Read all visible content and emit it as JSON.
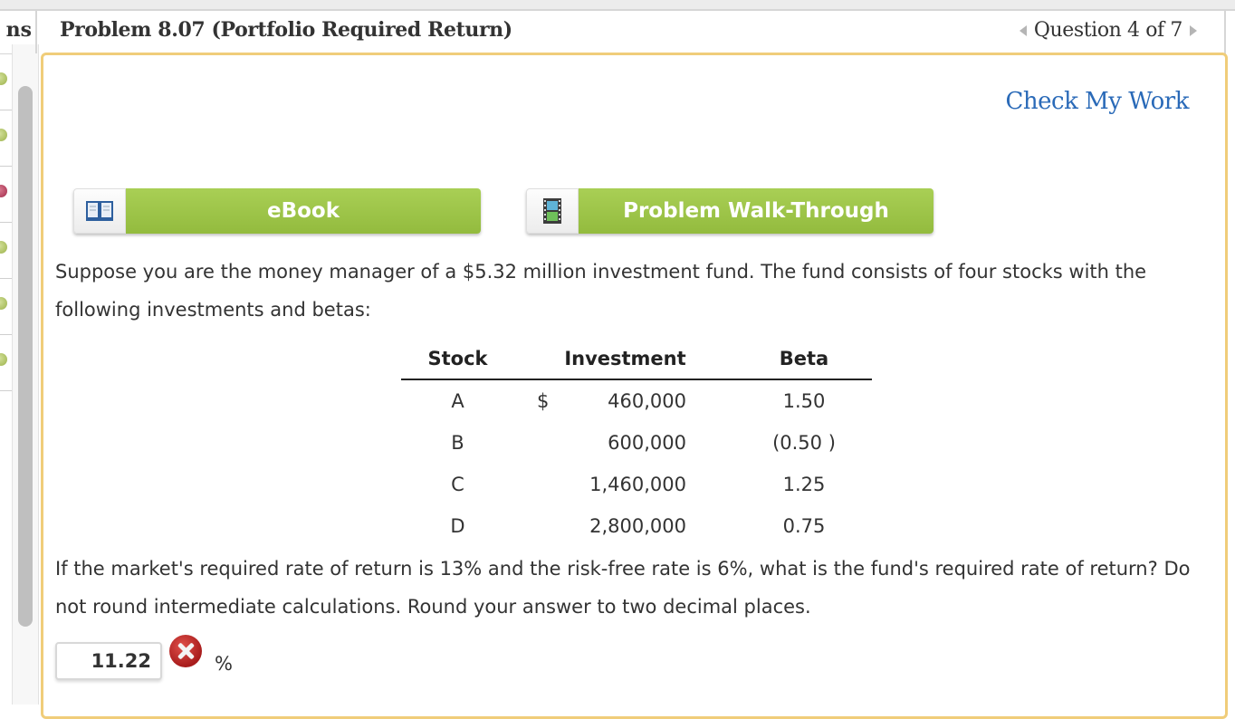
{
  "sidebar": {
    "header_fragment": "ns",
    "items": [
      {
        "status": "correct"
      },
      {
        "status": "correct"
      },
      {
        "status": "incorrect"
      },
      {
        "status": "correct"
      },
      {
        "status": "correct"
      },
      {
        "status": "correct"
      }
    ]
  },
  "header": {
    "title": "Problem 8.07 (Portfolio Required Return)",
    "question_nav": "Question 4 of 7"
  },
  "main": {
    "check_my_work": "Check My Work",
    "buttons": {
      "ebook": {
        "label": "eBook",
        "icon": "book-icon"
      },
      "walkthrough": {
        "label": "Problem Walk-Through",
        "icon": "film-icon"
      }
    },
    "intro": "Suppose you are the money manager of a $5.32 million investment fund. The fund consists of four stocks with the following investments and betas:",
    "table": {
      "headers": [
        "Stock",
        "Investment",
        "Beta"
      ],
      "rows": [
        {
          "stock": "A",
          "currency": "$",
          "investment": "460,000",
          "beta": "1.50"
        },
        {
          "stock": "B",
          "currency": "",
          "investment": "600,000",
          "beta": "(0.50 )"
        },
        {
          "stock": "C",
          "currency": "",
          "investment": "1,460,000",
          "beta": "1.25"
        },
        {
          "stock": "D",
          "currency": "",
          "investment": "2,800,000",
          "beta": "0.75"
        }
      ]
    },
    "question": "If the market's required rate of return is 13% and the risk-free rate is 6%, what is the fund's required rate of return? Do not round intermediate calculations. Round your answer to two decimal places.",
    "answer": {
      "value": "11.22",
      "status": "incorrect",
      "unit": "%"
    }
  },
  "colors": {
    "panel_border": "#f0cd7a",
    "link": "#2a6ab8",
    "button_green": "#9ec648",
    "incorrect_red": "#c0282a"
  }
}
